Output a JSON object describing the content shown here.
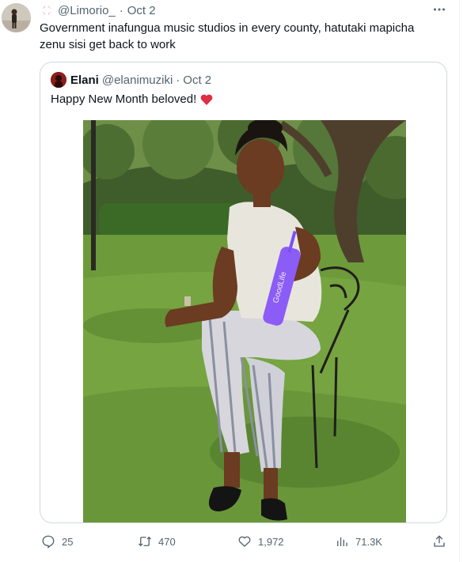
{
  "tweet": {
    "handle": "@Limorio_",
    "date": "Oct 2",
    "separator": "·",
    "text": "Government inafungua music studios in every county, hatutaki mapicha\nzenu sisi  get back to work"
  },
  "quote": {
    "name": "Elani",
    "handle": "@elanimuziki",
    "date": "Oct 2",
    "separator": "·",
    "text": "Happy New Month beloved!",
    "bottle_text": "GoodLife"
  },
  "actions": {
    "replies": "25",
    "retweets": "470",
    "likes": "1,972",
    "views": "71.3K"
  },
  "colors": {
    "text": "#0f1419",
    "secondary": "#536471",
    "border": "#cfd9de",
    "heart": "#e0245e"
  },
  "icons": [
    "anger-emoji-icon",
    "more-icon",
    "red-heart-emoji-icon",
    "reply-icon",
    "retweet-icon",
    "like-icon",
    "views-icon",
    "share-icon"
  ]
}
